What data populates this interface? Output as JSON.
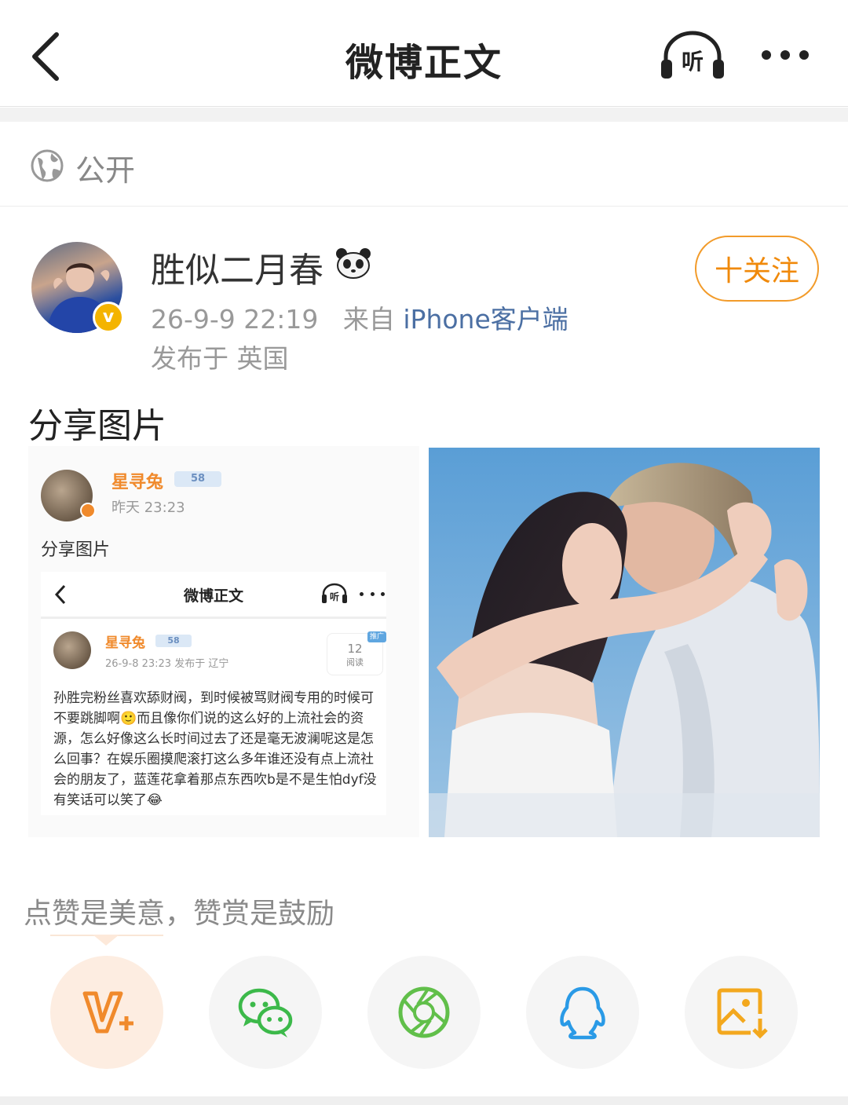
{
  "header": {
    "title": "微博正文",
    "listen_label": "听"
  },
  "visibility": {
    "label": "公开"
  },
  "post": {
    "author": "胜似二月春",
    "verified_mark": "v",
    "follow_label": "十关注",
    "time": "26-9-9 22:19",
    "source_prefix": "来自",
    "source": "iPhone客户端",
    "location": "发布于 英国",
    "text": "分享图片"
  },
  "screenshot": {
    "author": "星寻兔",
    "level": "58",
    "time": "昨天 23:23",
    "share_text": "分享图片",
    "inner_title": "微博正文",
    "inner_listen": "听",
    "inner_author": "星寻兔",
    "inner_level": "58",
    "inner_time": "26-9-8 23:23  发布于 辽宁",
    "inner_reads": "12",
    "inner_reads_label": "阅读",
    "inner_tag": "推广",
    "inner_body": "孙胜完粉丝喜欢舔财阀，到时候被骂财阀专用的时候可不要跳脚啊🙂而且像你们说的这么好的上流社会的资源，怎么好像这么长时间过去了还是毫无波澜呢这是怎么回事？在娱乐圈摸爬滚打这么多年谁还没有点上流社会的朋友了，蓝莲花拿着那点东西吹b是不是生怕dyf没有笑话可以笑了😂"
  },
  "reward": {
    "text": "点赞是美意，赞赏是鼓励"
  },
  "share_targets": [
    {
      "icon": "vplus-icon",
      "color": "#f08a2c"
    },
    {
      "icon": "wechat-icon",
      "color": "#3cb94a"
    },
    {
      "icon": "moments-icon",
      "color": "#61bf4a"
    },
    {
      "icon": "qq-icon",
      "color": "#2a9ae6"
    },
    {
      "icon": "save-image-icon",
      "color": "#f3a81e"
    }
  ]
}
